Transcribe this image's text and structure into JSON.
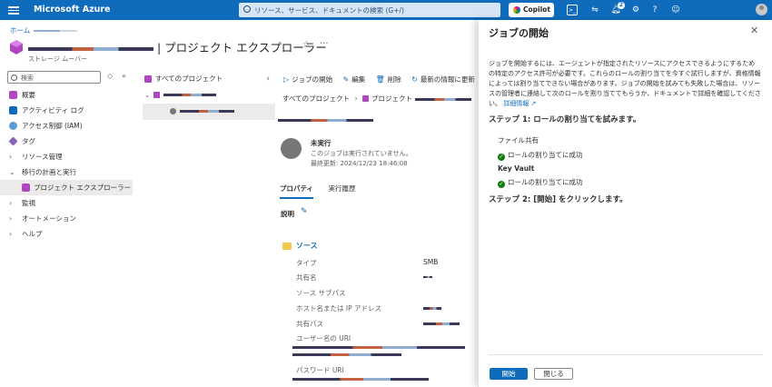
{
  "topbar": {
    "brand": "Microsoft Azure",
    "search_placeholder": "リソース、サービス、ドキュメントの検索 (G+/)",
    "copilot_label": "Copilot",
    "notification_count": "2"
  },
  "breadcrumb": {
    "home": "ホーム"
  },
  "page": {
    "title": "| プロジェクト エクスプローラー",
    "subtitle": "ストレージ ムーバー"
  },
  "nav": {
    "search_placeholder": "検索",
    "items": [
      {
        "label": "概要"
      },
      {
        "label": "アクティビティ ログ"
      },
      {
        "label": "アクセス制御 (IAM)"
      },
      {
        "label": "タグ"
      },
      {
        "label": "リソース管理"
      },
      {
        "label": "移行の計画と実行"
      },
      {
        "label": "プロジェクト エクスプローラー"
      },
      {
        "label": "監視"
      },
      {
        "label": "オートメーション"
      },
      {
        "label": "ヘルプ"
      }
    ]
  },
  "tree": {
    "all_projects": "すべてのプロジェクト"
  },
  "toolbar": {
    "start_job": "ジョブの開始",
    "edit": "編集",
    "delete": "削除",
    "refresh": "最新の情報に更新"
  },
  "content": {
    "path_all": "すべてのプロジェクト",
    "path_project": "プロジェクト",
    "status": "未実行",
    "status_desc": "このジョブは実行されていません。",
    "last_updated": "最終更新: 2024/12/23 18:46:08",
    "tab_properties": "プロパティ",
    "tab_history": "実行履歴",
    "description_label": "説明",
    "source_title": "ソース",
    "props": {
      "type": "タイプ",
      "type_value": "SMB",
      "share_name": "共有名",
      "source_subpath": "ソース サブパス",
      "host": "ホスト名または IP アドレス",
      "share_path": "共有パス",
      "username_uri": "ユーザー名の URI",
      "password_uri": "パスワード URI"
    }
  },
  "panel": {
    "title": "ジョブの開始",
    "intro": "ジョブを開始するには、エージェントが指定されたリソースにアクセスできるようにするための特定のアクセス許可が必要です。これらのロールの割り当てを今すぐ試行しますが、資格情報によっては割り当てできない場合があります。ジョブの開始を試みても失敗した場合は、リソースの管理者に連絡して次のロールを割り当ててもらうか、ドキュメントで詳細を確認してください。",
    "more_info": "詳細情報",
    "step1": "ステップ 1: ロールの割り当てを試みます。",
    "file_share": "ファイル共有",
    "role_success": "ロールの割り当てに成功",
    "key_vault": "Key Vault",
    "step2": "ステップ 2: [開始] をクリックします。",
    "start_button": "開始",
    "close_button": "閉じる"
  }
}
